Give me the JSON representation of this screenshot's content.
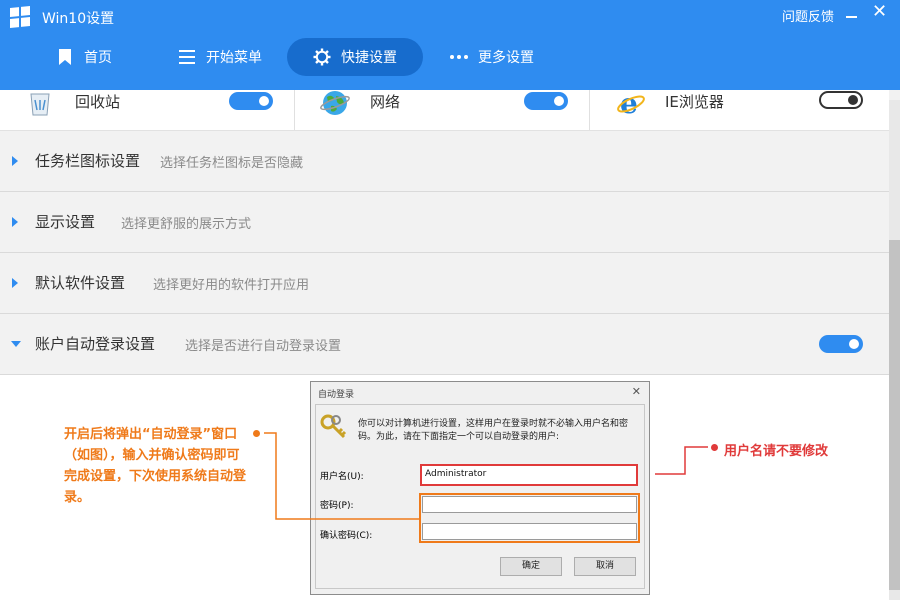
{
  "window": {
    "title": "Win10设置",
    "feedback": "问题反馈",
    "minimize_icon": "minimize-icon",
    "close_icon": "close-icon"
  },
  "nav": [
    {
      "label": "首页",
      "icon": "bookmark-icon",
      "active": false
    },
    {
      "label": "开始菜单",
      "icon": "menu-lines-icon",
      "active": false
    },
    {
      "label": "快捷设置",
      "icon": "gear-icon",
      "active": true
    },
    {
      "label": "更多设置",
      "icon": "more-dots-icon",
      "active": false
    }
  ],
  "quick_toggles": [
    {
      "label": "回收站",
      "icon": "recycle-bin-icon",
      "on": true
    },
    {
      "label": "网络",
      "icon": "network-globe-icon",
      "on": true
    },
    {
      "label": "IE浏览器",
      "icon": "ie-browser-icon",
      "on": false
    }
  ],
  "settings": [
    {
      "title": "任务栏图标设置",
      "desc": "选择任务栏图标是否隐藏",
      "expanded": false
    },
    {
      "title": "显示设置",
      "desc": "选择更舒服的展示方式",
      "expanded": false
    },
    {
      "title": "默认软件设置",
      "desc": "选择更好用的软件打开应用",
      "expanded": false
    },
    {
      "title": "账户自动登录设置",
      "desc": "选择是否进行自动登录设置",
      "expanded": true,
      "toggle_on": true
    }
  ],
  "dialog": {
    "title": "自动登录",
    "message": "你可以对计算机进行设置，这样用户在登录时就不必输入用户名和密码。为此，请在下面指定一个可以自动登录的用户:",
    "username_label": "用户名(U):",
    "username_value": "Administrator",
    "password_label": "密码(P):",
    "confirm_label": "确认密码(C):",
    "ok": "确定",
    "cancel": "取消"
  },
  "annotations": {
    "left": "开启后将弹出“自动登录”窗口（如图），输入并确认密码即可完成设置，下次使用系统自动登录。",
    "right": "用户名请不要修改"
  },
  "colors": {
    "header_blue": "#2f8cf0",
    "active_nav": "#176ccd",
    "annotation_orange": "#ef7a1a",
    "annotation_red": "#e03a3a"
  }
}
